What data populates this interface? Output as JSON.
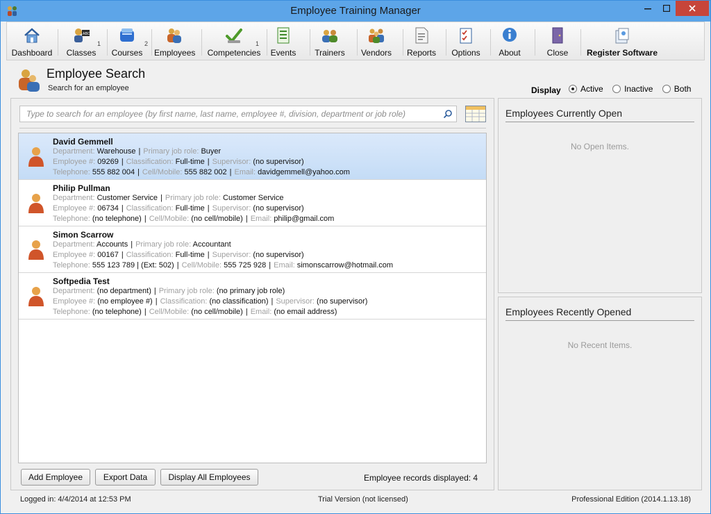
{
  "window": {
    "title": "Employee Training Manager"
  },
  "toolbar": {
    "items": [
      {
        "label": "Dashboard",
        "icon": "home-icon",
        "badge": ""
      },
      {
        "label": "Classes",
        "icon": "classes-icon",
        "badge": "1"
      },
      {
        "label": "Courses",
        "icon": "courses-icon",
        "badge": "2"
      },
      {
        "label": "Employees",
        "icon": "employees-icon",
        "badge": ""
      },
      {
        "label": "Competencies",
        "icon": "checkmark-icon",
        "badge": "1"
      },
      {
        "label": "Events",
        "icon": "events-icon",
        "badge": ""
      },
      {
        "label": "Trainers",
        "icon": "trainers-icon",
        "badge": ""
      },
      {
        "label": "Vendors",
        "icon": "vendors-icon",
        "badge": ""
      },
      {
        "label": "Reports",
        "icon": "report-icon",
        "badge": ""
      },
      {
        "label": "Options",
        "icon": "options-icon",
        "badge": ""
      },
      {
        "label": "About",
        "icon": "info-icon",
        "badge": ""
      },
      {
        "label": "Close",
        "icon": "door-icon",
        "badge": ""
      },
      {
        "label": "Register Software",
        "icon": "register-icon",
        "badge": ""
      }
    ]
  },
  "header": {
    "title": "Employee Search",
    "subtitle": "Search for an employee",
    "display_label": "Display",
    "display_options": [
      "Active",
      "Inactive",
      "Both"
    ],
    "display_selected": "Active"
  },
  "search": {
    "placeholder": "Type to search for an employee (by first name, last name, employee #, division, department or job role)"
  },
  "labels": {
    "department": "Department:",
    "job_role": "Primary job role:",
    "employee_no": "Employee #:",
    "classification": "Classification:",
    "supervisor": "Supervisor:",
    "telephone": "Telephone:",
    "cell": "Cell/Mobile:",
    "email": "Email:"
  },
  "employees": [
    {
      "name": "David Gemmell",
      "department": "Warehouse",
      "job_role": "Buyer",
      "employee_no": "09269",
      "classification": "Full-time",
      "supervisor": "(no supervisor)",
      "telephone": "555 882 004",
      "cell": "555 882 002",
      "email": "davidgemmell@yahoo.com",
      "selected": true
    },
    {
      "name": "Philip Pullman",
      "department": "Customer Service",
      "job_role": "Customer Service",
      "employee_no": "06734",
      "classification": "Full-time",
      "supervisor": "(no supervisor)",
      "telephone": "(no telephone)",
      "cell": "(no cell/mobile)",
      "email": "philip@gmail.com",
      "selected": false
    },
    {
      "name": "Simon Scarrow",
      "department": "Accounts",
      "job_role": "Accountant",
      "employee_no": "00167",
      "classification": "Full-time",
      "supervisor": "(no supervisor)",
      "telephone": "555 123 789 | (Ext: 502)",
      "cell": "555 725 928",
      "email": "simonscarrow@hotmail.com",
      "selected": false
    },
    {
      "name": "Softpedia Test",
      "department": "(no department)",
      "job_role": "(no primary job role)",
      "employee_no": "(no employee #)",
      "classification": "(no classification)",
      "supervisor": "(no supervisor)",
      "telephone": "(no telephone)",
      "cell": "(no cell/mobile)",
      "email": "(no email address)",
      "selected": false
    }
  ],
  "actions": {
    "add_label": "Add Employee",
    "export_label": "Export Data",
    "display_all_label": "Display All Employees",
    "records_text": "Employee records displayed: 4"
  },
  "side": {
    "open_title": "Employees Currently Open",
    "open_empty": "No Open Items.",
    "recent_title": "Employees Recently Opened",
    "recent_empty": "No Recent Items."
  },
  "status": {
    "login": "Logged in:  4/4/2014 at 12:53 PM",
    "trial": "Trial Version (not licensed)",
    "edition": "Professional Edition (2014.1.13.18)"
  },
  "colors": {
    "titlebar": "#5da5e8",
    "close_button": "#c7453a",
    "selected_row": "#c4dcf6",
    "key_label": "#a0a0a0"
  }
}
